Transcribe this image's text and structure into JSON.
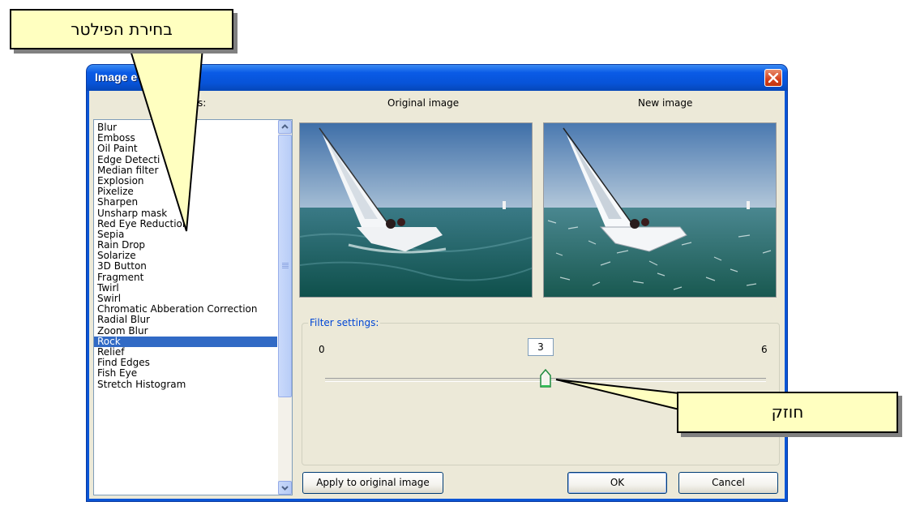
{
  "window": {
    "title": "Image e",
    "close_icon": "close-icon"
  },
  "headers": {
    "filters": "s:",
    "original": "Original image",
    "new": "New image"
  },
  "filters": [
    {
      "label": "Blur"
    },
    {
      "label": "Emboss"
    },
    {
      "label": "Oil Paint"
    },
    {
      "label": "Edge Detecti"
    },
    {
      "label": "Median filter"
    },
    {
      "label": "Explosion"
    },
    {
      "label": "Pixelize"
    },
    {
      "label": "Sharpen"
    },
    {
      "label": "Unsharp mask"
    },
    {
      "label": "Red Eye Reduction"
    },
    {
      "label": "Sepia"
    },
    {
      "label": "Rain Drop"
    },
    {
      "label": "Solarize"
    },
    {
      "label": "3D Button"
    },
    {
      "label": "Fragment"
    },
    {
      "label": "Twirl"
    },
    {
      "label": "Swirl"
    },
    {
      "label": "Chromatic Abberation Correction"
    },
    {
      "label": "Radial Blur"
    },
    {
      "label": "Zoom Blur"
    },
    {
      "label": "Rock",
      "selected": true
    },
    {
      "label": "Relief"
    },
    {
      "label": "Find Edges"
    },
    {
      "label": "Fish Eye"
    },
    {
      "label": "Stretch Histogram"
    }
  ],
  "settings": {
    "legend": "Filter settings:",
    "min": "0",
    "max": "6",
    "value": "3",
    "slider_fraction": 0.5
  },
  "buttons": {
    "apply": "Apply to original image",
    "ok": "OK",
    "cancel": "Cancel"
  },
  "callouts": {
    "filter_selection": "בחירת הפילטר",
    "strength": "חוזק"
  },
  "colors": {
    "title_bar": "#0a5be6",
    "selection": "#316ac5",
    "callout_fill": "#ffffc0",
    "close_button": "#d5401c"
  }
}
